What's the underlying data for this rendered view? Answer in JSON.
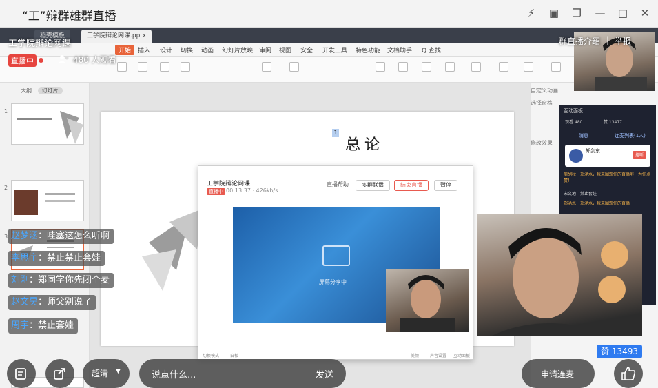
{
  "window": {
    "title": "“工”辩群雄群直播"
  },
  "desktop": {
    "tabs": [
      "稻壳模板",
      "工学院辩论网课.pptx"
    ],
    "menu": [
      "开始",
      "插入",
      "设计",
      "切换",
      "动画",
      "幻灯片放映",
      "审阅",
      "视图",
      "安全",
      "开发工具",
      "特色功能",
      "文档助手",
      "Q 查找"
    ],
    "thumb_tabs": {
      "outline": "大纲",
      "slides": "幻灯片"
    },
    "slide": {
      "badge": "1",
      "title": "总论"
    },
    "right_panel": [
      "自定义动画",
      "选择窗格",
      "修改效果"
    ],
    "share": {
      "title": "工学院辩论网课",
      "live_tag": "直播中",
      "stat": "00:13:37 · 426kb/s",
      "help": "直播帮助",
      "multi": "多群联播",
      "end": "结束直播",
      "pause": "暂停",
      "caption": "屏幕分享中",
      "foot": [
        "切换模式",
        "白板",
        "美颜",
        "声音设置",
        "互动面板"
      ]
    },
    "interaction": {
      "head": "互动面板",
      "viewers": "观看 480",
      "likes": "赞 13477",
      "tab_msg": "消息",
      "tab_mic": "连麦列表(1人)",
      "card_name": "郑剑东",
      "card_btn": "挂断",
      "msgs": [
        "周胡秋：郑涌水，我来围观你的直播啦，为你点赞！",
        "宋文地：禁止套娃",
        "郑涌水：郑涌水，我来围观你的直播"
      ]
    }
  },
  "live": {
    "room_name": "工学院辩论网课",
    "live_badge": "直播中",
    "viewers": "480 人观看",
    "intro": "群直播介绍",
    "separator": "|",
    "report": "举报",
    "likes": "赞 13493"
  },
  "danmaku": [
    {
      "name": "赵梦涵",
      "text": "：哇塞这怎么听啊"
    },
    {
      "name": "李思宇",
      "text": "：禁止禁止套娃"
    },
    {
      "name": "刘刚",
      "text": "：郑同学你先闭个麦"
    },
    {
      "name": "赵文昊",
      "text": "：师父别说了"
    },
    {
      "name": "周宇",
      "text": "：禁止套娃"
    }
  ],
  "bottom": {
    "quality": "超清",
    "comment_placeholder": "说点什么...",
    "send": "发送",
    "apply_mic": "申请连麦"
  }
}
